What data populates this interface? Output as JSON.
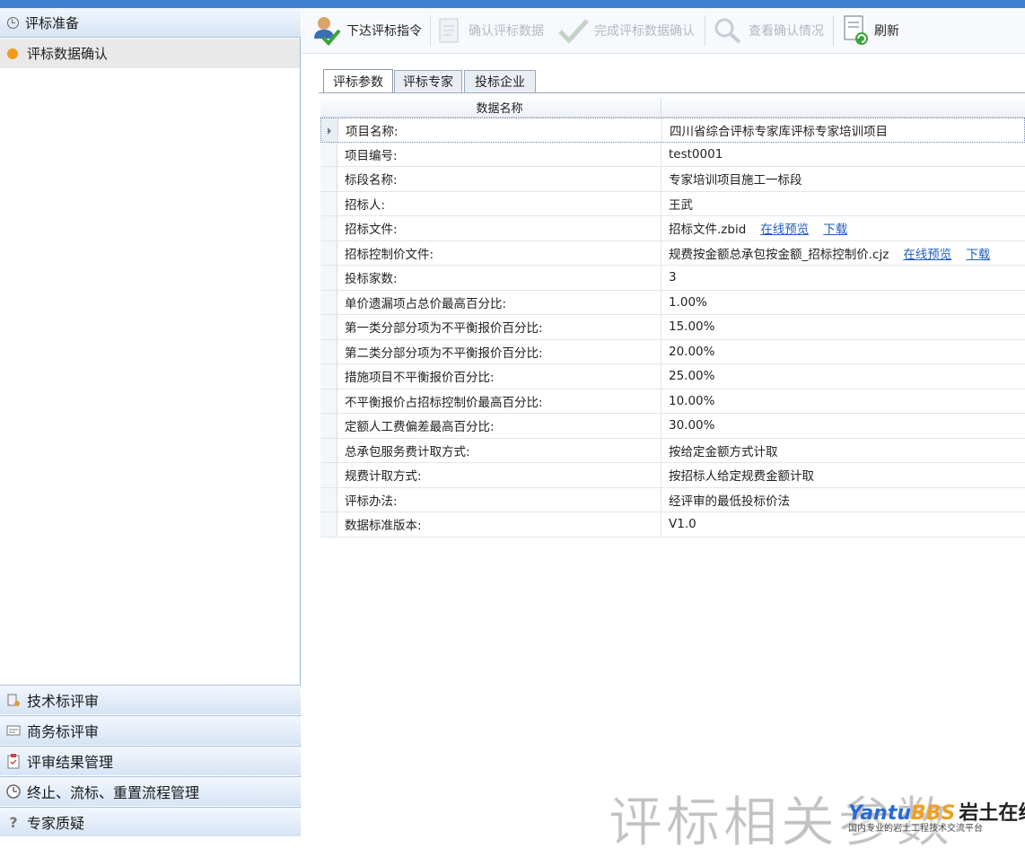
{
  "sidebar": {
    "header": "评标准备",
    "active_item": "评标数据确认",
    "bottom_items": [
      {
        "label": "技术标评审",
        "icon": "tech-review-icon"
      },
      {
        "label": "商务标评审",
        "icon": "business-review-icon"
      },
      {
        "label": "评审结果管理",
        "icon": "clipboard-icon"
      },
      {
        "label": "终止、流标、重置流程管理",
        "icon": "clock-icon"
      },
      {
        "label": "专家质疑",
        "icon": "question-icon"
      }
    ]
  },
  "toolbar": {
    "issue_label": "下达评标指令",
    "confirm_label": "确认评标数据",
    "complete_label": "完成评标数据确认",
    "view_label": "查看确认情况",
    "refresh_label": "刷新"
  },
  "tabs": [
    {
      "label": "评标参数",
      "active": true
    },
    {
      "label": "评标专家",
      "active": false
    },
    {
      "label": "投标企业",
      "active": false
    }
  ],
  "grid": {
    "header": "数据名称",
    "link_preview": "在线预览",
    "link_download": "下载",
    "rows": [
      {
        "name": "项目名称:",
        "value": "四川省综合评标专家库评标专家培训项目"
      },
      {
        "name": "项目编号:",
        "value": "test0001"
      },
      {
        "name": "标段名称:",
        "value": "专家培训项目施工一标段"
      },
      {
        "name": "招标人:",
        "value": "王武"
      },
      {
        "name": "招标文件:",
        "value": "招标文件.zbid"
      },
      {
        "name": "招标控制价文件:",
        "value": "规费按金额总承包按金额_招标控制价.cjz"
      },
      {
        "name": "投标家数:",
        "value": "3"
      },
      {
        "name": "单价遗漏项占总价最高百分比:",
        "value": "1.00%"
      },
      {
        "name": "第一类分部分项为不平衡报价百分比:",
        "value": "15.00%"
      },
      {
        "name": "第二类分部分项为不平衡报价百分比:",
        "value": "20.00%"
      },
      {
        "name": "措施项目不平衡报价百分比:",
        "value": "25.00%"
      },
      {
        "name": "不平衡报价占招标控制价最高百分比:",
        "value": "10.00%"
      },
      {
        "name": "定额人工费偏差最高百分比:",
        "value": "30.00%"
      },
      {
        "name": "总承包服务费计取方式:",
        "value": "按给定金额方式计取"
      },
      {
        "name": "规费计取方式:",
        "value": "按招标人给定规费金额计取"
      },
      {
        "name": "评标办法:",
        "value": "经评审的最低投标价法"
      },
      {
        "name": "数据标准版本:",
        "value": "V1.0"
      }
    ]
  },
  "watermark": {
    "big_text": "评标相关参数",
    "logo_a": "Yantu",
    "logo_b": "BBS",
    "logo_cn": "岩土在线",
    "sub": "国内专业的岩土工程技术交流平台"
  }
}
